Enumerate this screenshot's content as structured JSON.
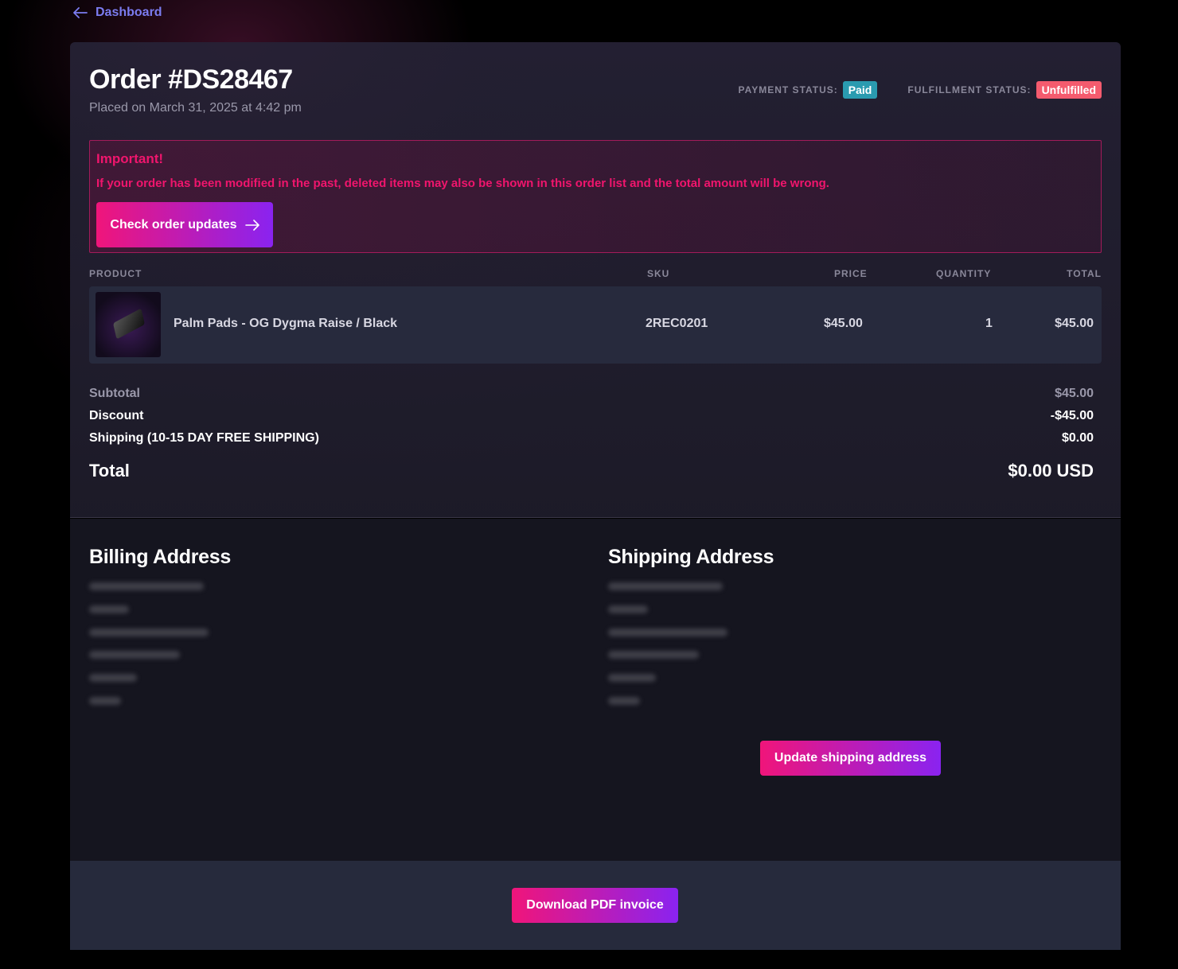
{
  "nav": {
    "back_label": "Dashboard"
  },
  "order": {
    "title": "Order #DS28467",
    "placed": "Placed on March 31, 2025 at 4:42 pm",
    "payment_status_label": "PAYMENT STATUS:",
    "payment_status": "Paid",
    "fulfillment_status_label": "FULFILLMENT STATUS:",
    "fulfillment_status": "Unfulfilled"
  },
  "alert": {
    "title": "Important!",
    "text": "If your order has been modified in the past, deleted items may also be shown in this order list and the total amount will be wrong.",
    "button": "Check order updates"
  },
  "table": {
    "headers": {
      "product": "PRODUCT",
      "sku": "SKU",
      "price": "PRICE",
      "quantity": "QUANTITY",
      "total": "TOTAL"
    },
    "rows": [
      {
        "product": "Palm Pads - OG Dygma Raise / Black",
        "sku": "2REC0201",
        "price": "$45.00",
        "quantity": "1",
        "total": "$45.00"
      }
    ]
  },
  "summary": {
    "subtotal_label": "Subtotal",
    "subtotal": "$45.00",
    "discount_label": "Discount",
    "discount": "-$45.00",
    "shipping_label": "Shipping (10-15 DAY FREE SHIPPING)",
    "shipping": "$0.00",
    "total_label": "Total",
    "total": "$0.00 USD"
  },
  "addresses": {
    "billing_title": "Billing Address",
    "shipping_title": "Shipping Address",
    "update_button": "Update shipping address"
  },
  "footer": {
    "download_button": "Download PDF invoice"
  },
  "colors": {
    "accent_pink": "#f0157a",
    "accent_purple": "#8a23f0",
    "link": "#7b7cf0",
    "paid": "#2a9bb0",
    "unfulfilled": "#f45b6e",
    "alert_text": "#f0156d"
  }
}
